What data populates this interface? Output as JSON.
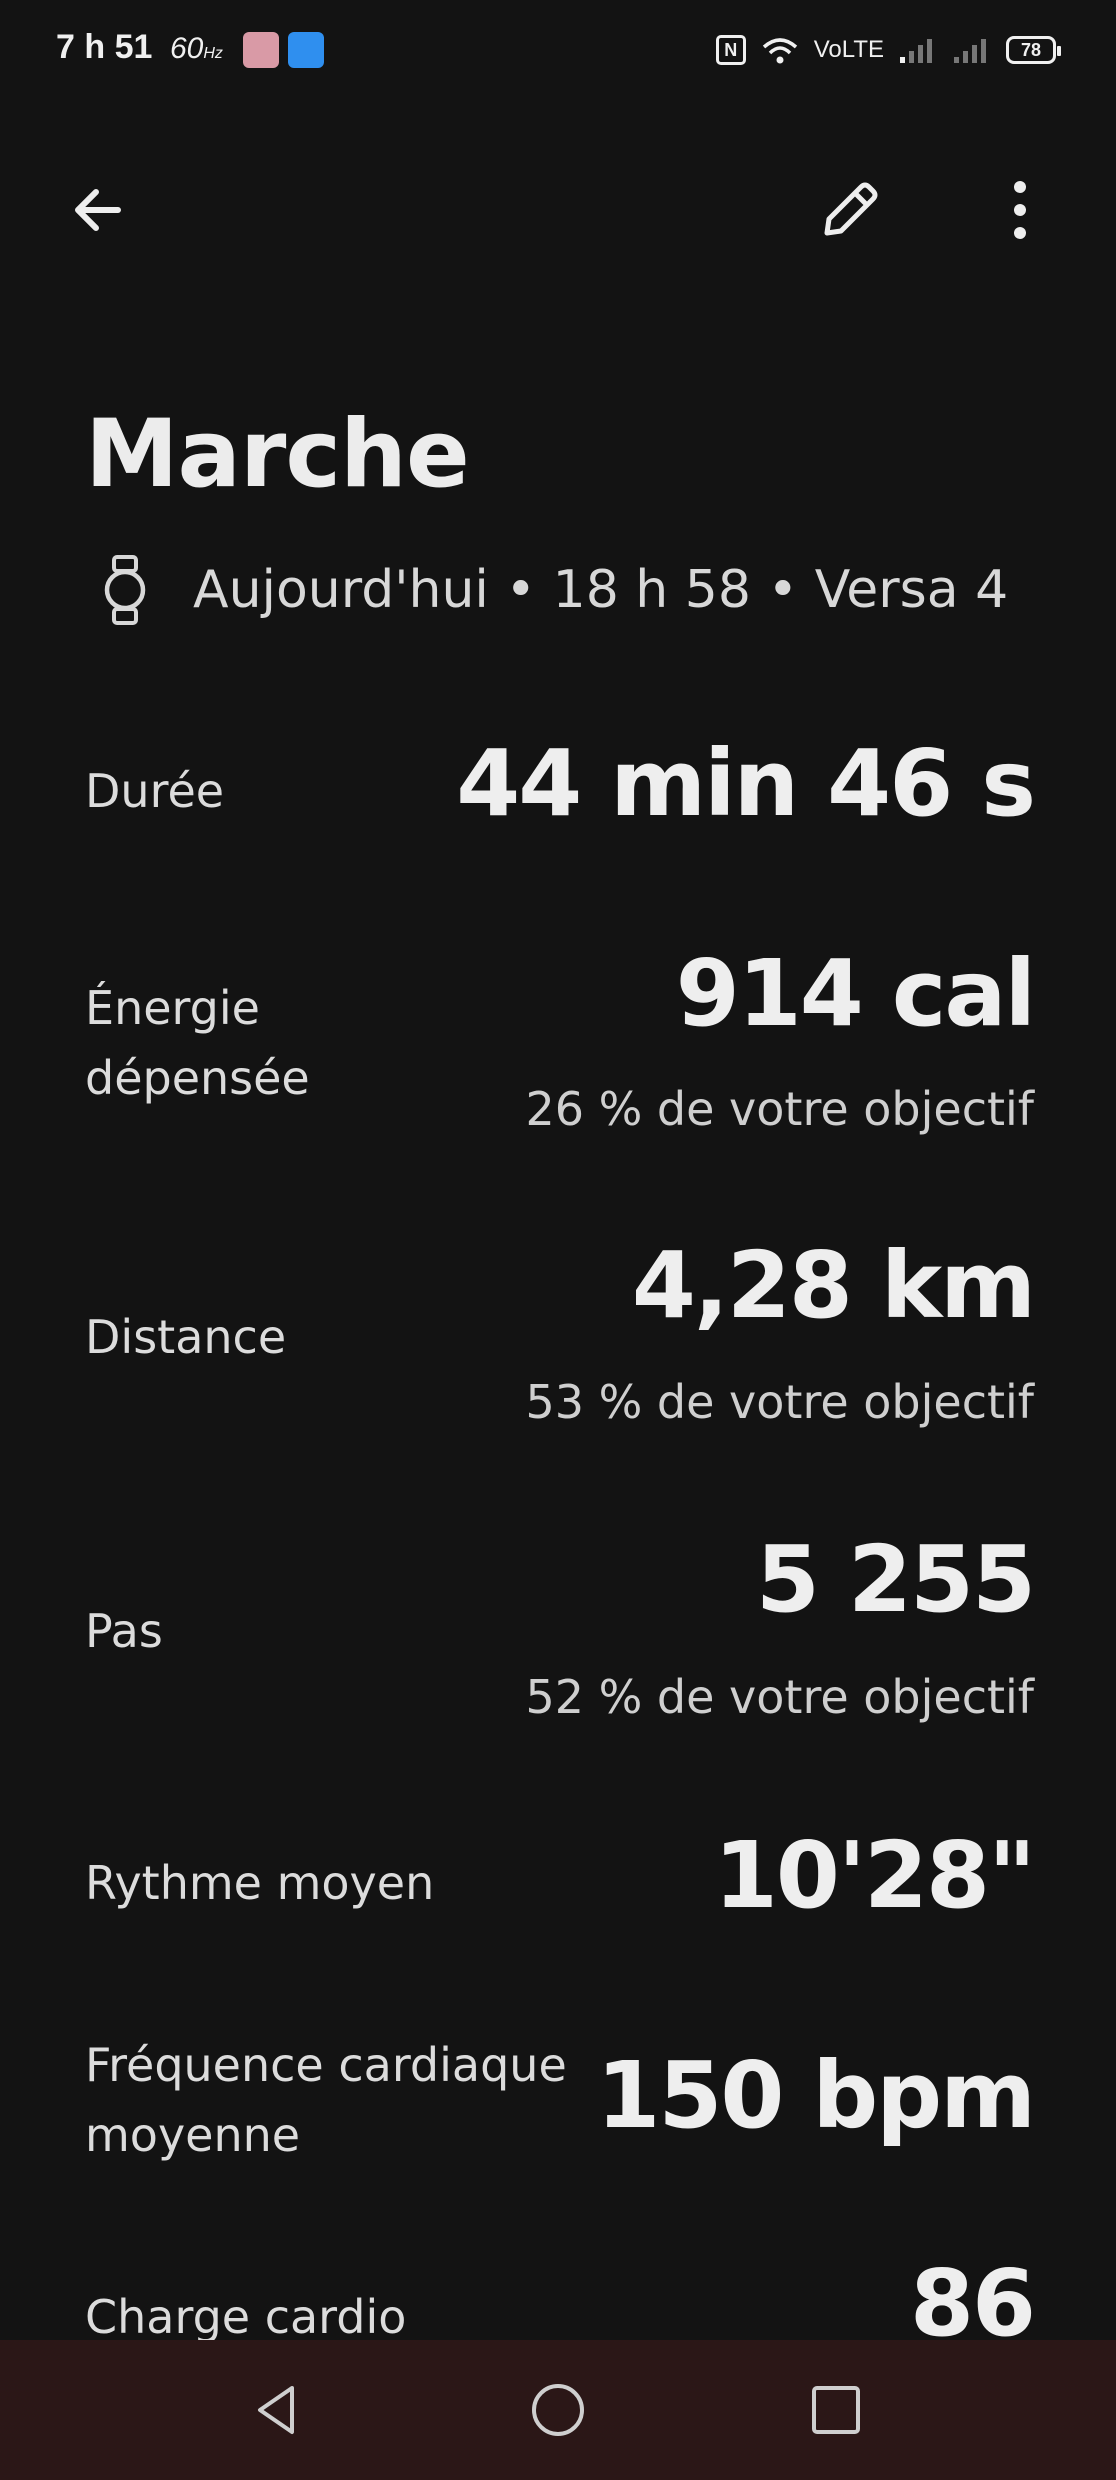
{
  "status_bar": {
    "time": "7 h 51",
    "refresh_rate": "60",
    "refresh_unit": "Hz",
    "nfc": "N",
    "volte": "VoLTE",
    "battery": "78"
  },
  "header": {
    "title": "Marche",
    "subtitle": "Aujourd'hui • 18 h 58 • Versa 4",
    "icons": [
      "back-arrow-icon",
      "pencil-icon",
      "more-vert-icon",
      "watch-icon"
    ]
  },
  "metrics": {
    "duration": {
      "label": "Durée",
      "value": "44 min 46 s"
    },
    "energy": {
      "label_line1": "Énergie",
      "label_line2": "dépensée",
      "value": "914 cal",
      "sub": "26 % de votre objectif"
    },
    "distance": {
      "label": "Distance",
      "value": "4,28 km",
      "sub": "53 % de votre objectif"
    },
    "steps": {
      "label": "Pas",
      "value": "5 255",
      "sub": "52 % de votre objectif"
    },
    "pace": {
      "label": "Rythme moyen",
      "value": "10'28\""
    },
    "heart_rate": {
      "label_line1": "Fréquence cardiaque",
      "label_line2": "moyenne",
      "value": "150 bpm"
    },
    "cardio_load": {
      "label": "Charge cardio",
      "value": "86"
    }
  },
  "colors": {
    "background": "#131313",
    "text_primary": "#eeeeee",
    "text_secondary": "#cfcfcf",
    "nav_bar": "#2b1717"
  }
}
